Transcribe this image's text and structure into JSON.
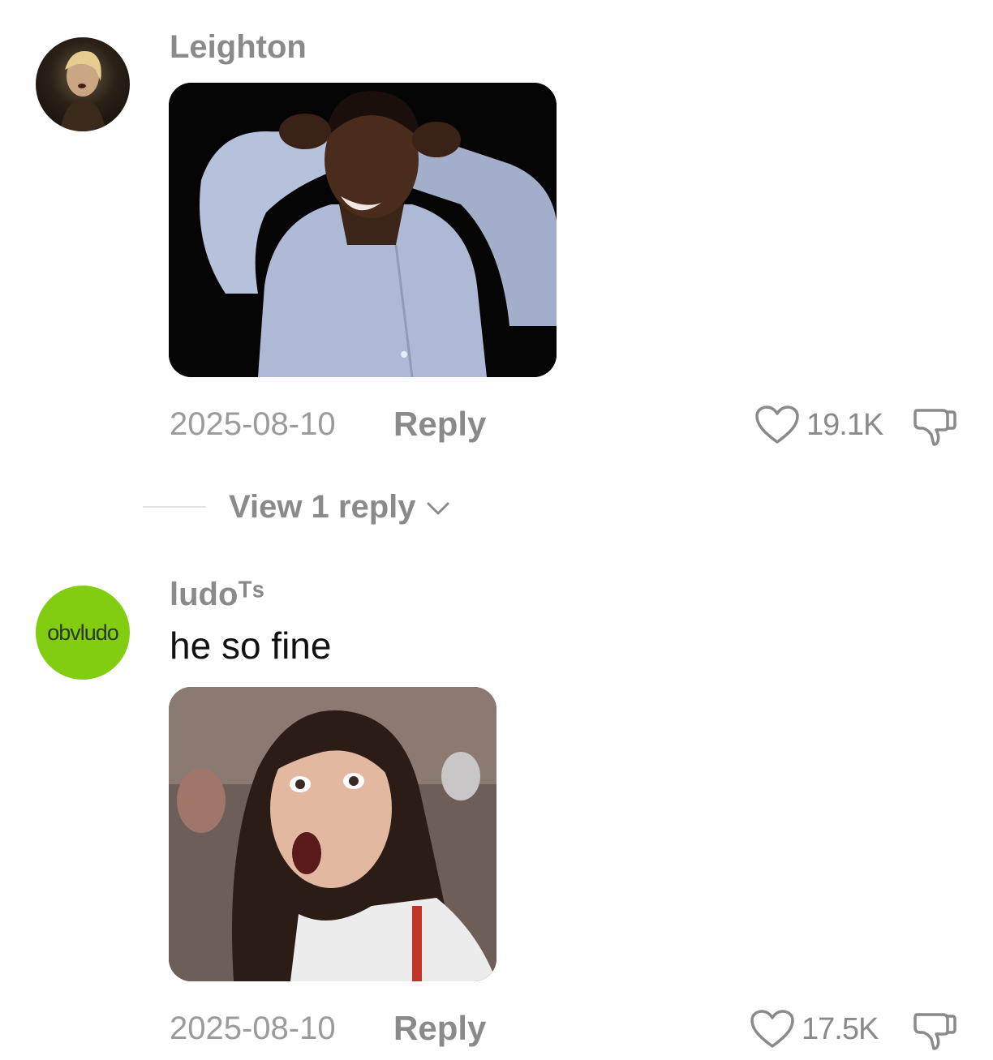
{
  "comments": [
    {
      "username": "Leighton",
      "text": "",
      "date": "2025-08-10",
      "reply_label": "Reply",
      "likes": "19.1K",
      "avatar_icon": "profile-photo",
      "media_description_icon": "gif-man-dancing"
    },
    {
      "username": "ludoᵀˢ",
      "avatar_text": "obvludo",
      "text": "he so fine",
      "date": "2025-08-10",
      "reply_label": "Reply",
      "likes": "17.5K",
      "avatar_icon": "profile-logo",
      "media_description_icon": "gif-woman-shocked"
    }
  ],
  "view_replies": {
    "label": "View 1 reply"
  },
  "colors": {
    "muted": "#8a8a8a",
    "text": "#111111",
    "avatar_green": "#82cc12"
  }
}
